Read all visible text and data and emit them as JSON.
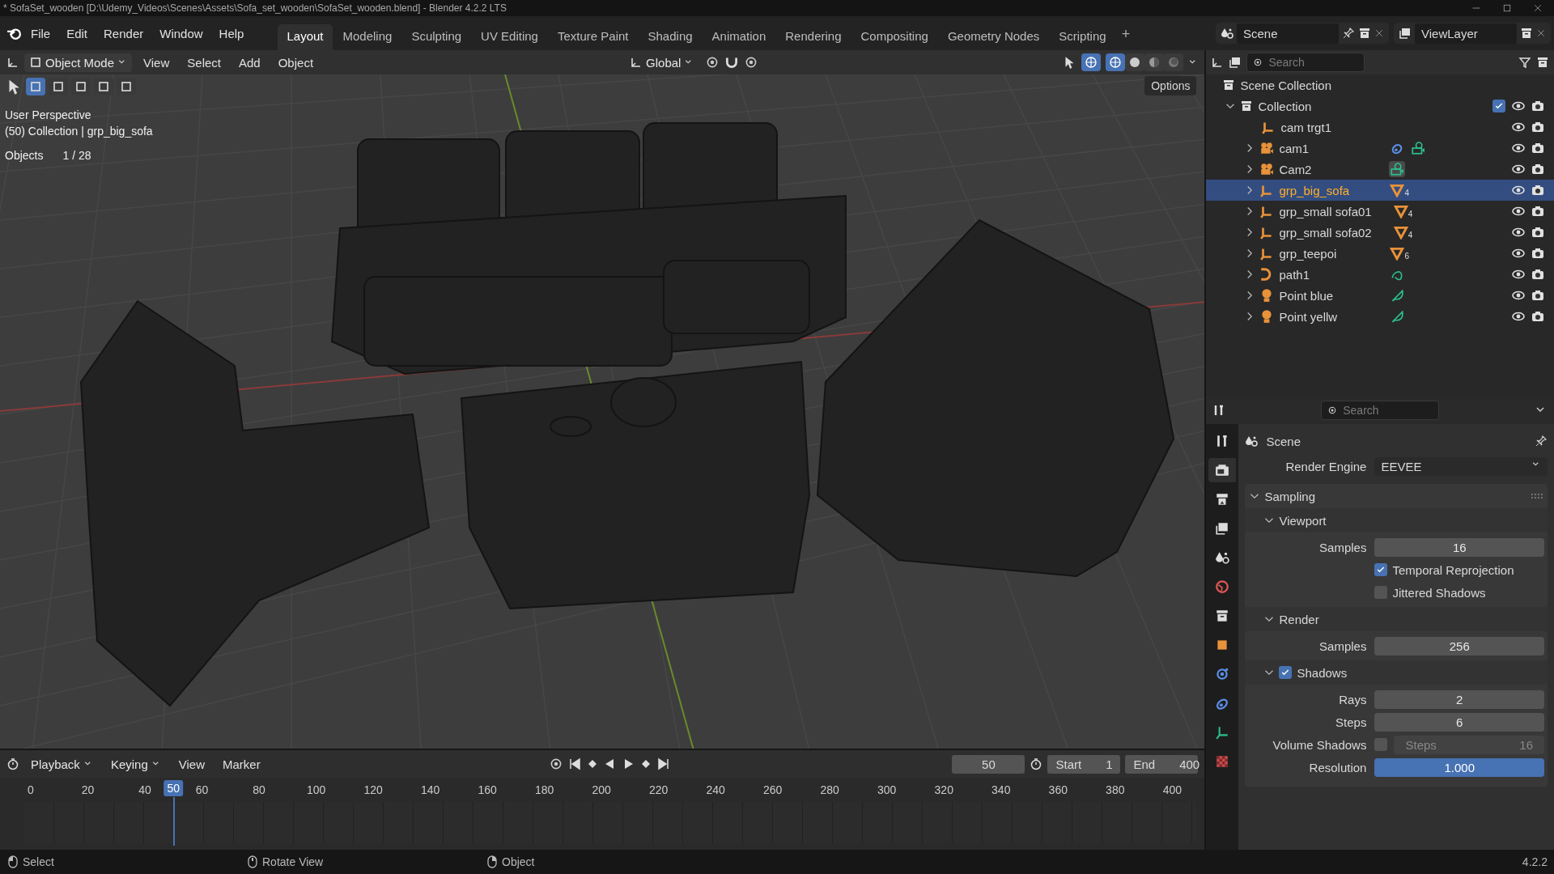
{
  "title_bar": {
    "title": "* SofaSet_wooden [D:\\Udemy_Videos\\Scenes\\Assets\\Sofa_set_wooden\\SofaSet_wooden.blend] - Blender 4.2.2 LTS"
  },
  "menu": [
    "File",
    "Edit",
    "Render",
    "Window",
    "Help"
  ],
  "workspaces": [
    {
      "label": "Layout",
      "selected": true
    },
    {
      "label": "Modeling",
      "selected": false
    },
    {
      "label": "Sculpting",
      "selected": false
    },
    {
      "label": "UV Editing",
      "selected": false
    },
    {
      "label": "Texture Paint",
      "selected": false
    },
    {
      "label": "Shading",
      "selected": false
    },
    {
      "label": "Animation",
      "selected": false
    },
    {
      "label": "Rendering",
      "selected": false
    },
    {
      "label": "Compositing",
      "selected": false
    },
    {
      "label": "Geometry Nodes",
      "selected": false
    },
    {
      "label": "Scripting",
      "selected": false
    }
  ],
  "workspace_add": "+",
  "scene": {
    "label": "Scene"
  },
  "view_layer": {
    "label": "ViewLayer"
  },
  "viewport_header": {
    "mode": "Object Mode",
    "menus": [
      "View",
      "Select",
      "Add",
      "Object"
    ],
    "orientation": "Global",
    "shading": [
      {
        "kind": "wireframe",
        "selected": true
      },
      {
        "kind": "solid",
        "selected": false
      },
      {
        "kind": "material",
        "selected": false
      },
      {
        "kind": "rendered",
        "selected": false
      }
    ]
  },
  "select_modes": [
    {
      "selected": true
    },
    {
      "selected": false
    },
    {
      "selected": false
    },
    {
      "selected": false
    },
    {
      "selected": false
    }
  ],
  "options": "Options",
  "viewport_info": {
    "view": "User Perspective",
    "context": "(50) Collection | grp_big_sofa",
    "stats_label": "Objects",
    "stats_value": "1 / 28"
  },
  "outliner": {
    "search_placeholder": "Search",
    "root": "Scene Collection",
    "collection": {
      "label": "Collection",
      "expanded": true,
      "checked": true
    },
    "items": [
      {
        "label": "cam trgt1",
        "kind": "empty",
        "selected": false
      },
      {
        "label": "cam1",
        "kind": "camera",
        "selected": false,
        "expanded": false,
        "badges": [
          {
            "kind": "constraint",
            "active": false
          },
          {
            "kind": "camera_data",
            "active": false
          }
        ]
      },
      {
        "label": "Cam2",
        "kind": "camera",
        "selected": false,
        "expanded": false,
        "badges": [
          {
            "kind": "camera_data",
            "active": true
          }
        ]
      },
      {
        "label": "grp_big_sofa",
        "kind": "empty",
        "selected": true,
        "expanded": false,
        "badges": [
          {
            "kind": "mesh",
            "count": "4",
            "active": false
          }
        ]
      },
      {
        "label": "grp_small sofa01",
        "kind": "empty",
        "selected": false,
        "expanded": false,
        "badges": [
          {
            "kind": "mesh",
            "count": "4",
            "active": false
          }
        ]
      },
      {
        "label": "grp_small sofa02",
        "kind": "empty",
        "selected": false,
        "expanded": false,
        "badges": [
          {
            "kind": "mesh",
            "count": "4",
            "active": false
          }
        ]
      },
      {
        "label": "grp_teepoi",
        "kind": "empty",
        "selected": false,
        "expanded": false,
        "badges": [
          {
            "kind": "mesh",
            "count": "6",
            "active": false
          }
        ]
      },
      {
        "label": "path1",
        "kind": "curve",
        "selected": false,
        "expanded": false,
        "badges": [
          {
            "kind": "curve_data",
            "active": false
          }
        ]
      },
      {
        "label": "Point blue",
        "kind": "light",
        "selected": false,
        "expanded": false,
        "badges": [
          {
            "kind": "light_data",
            "active": false
          }
        ]
      },
      {
        "label": "Point yellw",
        "kind": "light",
        "selected": false,
        "expanded": false,
        "badges": [
          {
            "kind": "light_data",
            "active": false
          }
        ]
      }
    ]
  },
  "properties": {
    "search_placeholder": "Search",
    "tabs": [
      {
        "kind": "tool",
        "selected": false
      },
      {
        "kind": "render",
        "selected": true
      },
      {
        "kind": "output",
        "selected": false
      },
      {
        "kind": "view_layer",
        "selected": false
      },
      {
        "kind": "scene",
        "selected": false
      },
      {
        "kind": "world",
        "selected": false
      },
      {
        "kind": "collection",
        "selected": false
      },
      {
        "kind": "object",
        "selected": false
      },
      {
        "kind": "physics",
        "selected": false
      },
      {
        "kind": "constraints",
        "selected": false
      },
      {
        "kind": "data",
        "selected": false
      },
      {
        "kind": "texture",
        "selected": false
      }
    ],
    "context": "Scene",
    "engine_label": "Render Engine",
    "engine": "EEVEE",
    "panel": {
      "title": "Sampling",
      "expanded": true,
      "sections": [
        {
          "title": "Viewport",
          "expanded": true,
          "rows": [
            {
              "kind": "number",
              "label": "Samples",
              "value": "16",
              "active": false
            },
            {
              "kind": "checkbox",
              "label": "Temporal Reprojection",
              "checked": true
            },
            {
              "kind": "checkbox",
              "label": "Jittered Shadows",
              "checked": false
            }
          ]
        },
        {
          "title": "Render",
          "expanded": true,
          "rows": [
            {
              "kind": "number",
              "label": "Samples",
              "value": "256",
              "active": false
            }
          ]
        },
        {
          "title": "Shadows",
          "expanded": true,
          "checked": true,
          "rows": [
            {
              "kind": "number",
              "label": "Rays",
              "value": "2",
              "active": false
            },
            {
              "kind": "number",
              "label": "Steps",
              "value": "6",
              "active": false
            },
            {
              "kind": "toggle_number",
              "label": "Volume Shadows",
              "checked": false,
              "field_label": "Steps",
              "value": "16"
            },
            {
              "kind": "number",
              "label": "Resolution",
              "value": "1.000",
              "active": true
            }
          ]
        }
      ]
    }
  },
  "timeline": {
    "menus": [
      "Playback",
      "Keying",
      "View",
      "Marker"
    ],
    "current_frame": "50",
    "start_label": "Start",
    "start": "1",
    "end_label": "End",
    "end": "400",
    "ticks": [
      "0",
      "20",
      "40",
      "60",
      "80",
      "100",
      "120",
      "140",
      "160",
      "180",
      "200",
      "220",
      "240",
      "260",
      "280",
      "300",
      "320",
      "340",
      "360",
      "380",
      "400"
    ],
    "playhead": {
      "label": "50",
      "level": 0.125
    }
  },
  "status_bar": {
    "hints": [
      {
        "kind": "left_mouse",
        "label": "Select"
      },
      {
        "kind": "middle_mouse",
        "label": "Rotate View"
      },
      {
        "kind": "right_mouse",
        "label": "Object"
      }
    ],
    "version": "4.2.2"
  }
}
